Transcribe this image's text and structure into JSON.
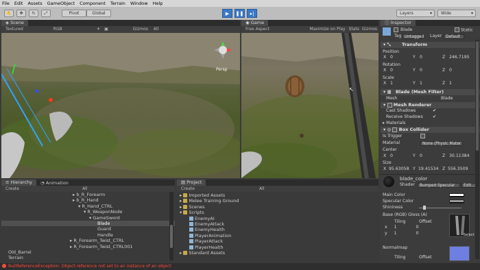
{
  "menu": [
    "File",
    "Edit",
    "Assets",
    "GameObject",
    "Component",
    "Terrain",
    "Window",
    "Help"
  ],
  "toolbar": {
    "pivot": "Pivot",
    "global": "Global",
    "layers": "Layers",
    "layout": "Wide"
  },
  "scene": {
    "tab": "Scene",
    "render_mode": "Textured",
    "color_mode": "RGB",
    "gizmos": "Gizmos",
    "all": "All",
    "persp": "Persp"
  },
  "game": {
    "tab": "Game",
    "aspect": "Free Aspect",
    "maximize": "Maximize on Play",
    "stats": "Stats",
    "gizmos": "Gizmos"
  },
  "hierarchy": {
    "tab": "Hierarchy",
    "create": "Create",
    "all": "All",
    "items": [
      "b_R_Forearm",
      "b_R_Hand",
      "R_Hand_CTRL",
      "R_WeaponNode",
      "GameSword",
      "Blade",
      "Guard",
      "Handle",
      "R_Forearm_Twist_CTRL",
      "R_Forearm_Twist_CTRL001",
      "Old_Barrel",
      "Terrain"
    ]
  },
  "animation": {
    "tab": "Animation"
  },
  "project": {
    "tab": "Project",
    "create": "Create",
    "all": "All",
    "folders": [
      "Imported Assets",
      "Melee Training Ground",
      "Scenes",
      "Scripts",
      "Standard Assets"
    ],
    "scripts": [
      "EnemyAI",
      "EnemyAttack",
      "EnemyHealth",
      "PlayerAnimation",
      "PlayerAttack",
      "PlayerHealth"
    ]
  },
  "inspector": {
    "tab": "Inspector",
    "name": "Blade",
    "static": "Static",
    "tag_label": "Tag",
    "tag": "Untagged",
    "layer_label": "Layer",
    "layer": "Default",
    "transform": {
      "title": "Transform",
      "position": "Position",
      "rotation": "Rotation",
      "scale": "Scale",
      "pos": {
        "x": "0",
        "y": "0",
        "z": "246.7195"
      },
      "rot": {
        "x": "0",
        "y": "0",
        "z": "0"
      },
      "scl": {
        "x": "1",
        "y": "1",
        "z": "1"
      }
    },
    "meshfilter": {
      "title": "Blade (Mesh Filter)",
      "mesh_label": "Mesh",
      "mesh": "Blade"
    },
    "meshrenderer": {
      "title": "Mesh Renderer",
      "cast": "Cast Shadows",
      "receive": "Receive Shadows",
      "materials": "Materials"
    },
    "boxcollider": {
      "title": "Box Collider",
      "trigger": "Is Trigger",
      "material_label": "Material",
      "material": "None (Physic Mater",
      "center": "Center",
      "cx": "0",
      "cy": "0",
      "cz": "30.11384",
      "size": "Size",
      "sx": "95.63058",
      "sy": "19.41534",
      "sz": "556.3509"
    },
    "material": {
      "name": "blade_color",
      "shader_label": "Shader",
      "shader": "Bumped Specular",
      "edit": "Edit...",
      "main_color": "Main Color",
      "spec_color": "Specular Color",
      "shininess": "Shininess",
      "base": "Base (RGB) Gloss (A)",
      "tiling": "Tiling",
      "offset": "Offset",
      "tx": "1",
      "ty": "1",
      "ox": "0",
      "oy": "0",
      "select": "Select",
      "normalmap": "Normalmap"
    }
  },
  "status": {
    "message": "NullReferenceException: Object reference not set to an instance of an object"
  },
  "colors": {
    "play_blue": "#3b78c4",
    "error_red": "#ff4a3a",
    "normalmap": "#6d7fe0"
  }
}
